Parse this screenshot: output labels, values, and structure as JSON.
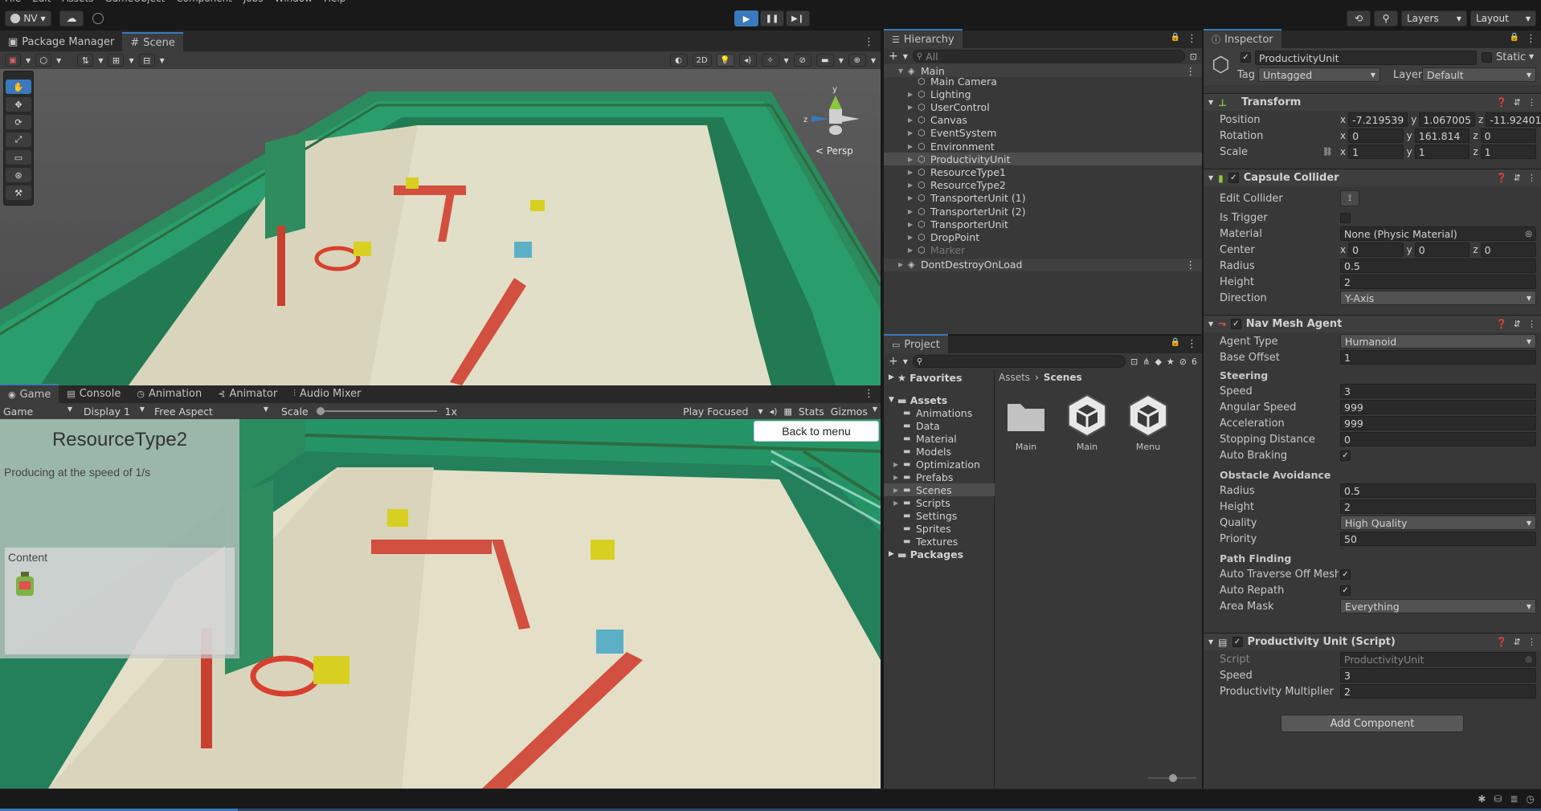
{
  "menubar": {
    "items": [
      "File",
      "Edit",
      "Assets",
      "GameObject",
      "Component",
      "Jobs",
      "Window",
      "Help"
    ]
  },
  "topbar": {
    "account": "NV",
    "layers": "Layers",
    "layout": "Layout"
  },
  "scene_tabs": {
    "package_manager": "Package Manager",
    "scene": "Scene"
  },
  "scene_toolbar": {
    "mode_2d": "2D",
    "persp": "< Persp"
  },
  "game_tabs": {
    "game": "Game",
    "console": "Console",
    "animation": "Animation",
    "animator": "Animator",
    "audio_mixer": "Audio Mixer"
  },
  "game_toolbar": {
    "view": "Game",
    "display": "Display 1",
    "aspect": "Free Aspect",
    "scale_label": "Scale",
    "scale_value": "1x",
    "play_mode": "Play Focused",
    "stats": "Stats",
    "gizmos": "Gizmos"
  },
  "game_ui": {
    "title": "ResourceType2",
    "subtitle": "Producing at the speed of 1/s",
    "content_label": "Content",
    "back_button": "Back to menu"
  },
  "hierarchy": {
    "title": "Hierarchy",
    "search_placeholder": "All",
    "scene": "Main",
    "items": [
      "Main Camera",
      "Lighting",
      "UserControl",
      "Canvas",
      "EventSystem",
      "Environment",
      "ProductivityUnit",
      "ResourceType1",
      "ResourceType2",
      "TransporterUnit (1)",
      "TransporterUnit (2)",
      "TransporterUnit",
      "DropPoint",
      "Marker"
    ],
    "dont_destroy": "DontDestroyOnLoad"
  },
  "project": {
    "title": "Project",
    "favorites": "Favorites",
    "assets": "Assets",
    "folders": [
      "Animations",
      "Data",
      "Material",
      "Models",
      "Optimization",
      "Prefabs",
      "Scenes",
      "Scripts",
      "Settings",
      "Sprites",
      "Textures"
    ],
    "packages": "Packages",
    "breadcrumb_root": "Assets",
    "breadcrumb_current": "Scenes",
    "hidden_count": "6",
    "files": [
      {
        "name": "Main",
        "icon": "folder-icon"
      },
      {
        "name": "Main",
        "icon": "unity-scene-icon"
      },
      {
        "name": "Menu",
        "icon": "unity-scene-icon"
      }
    ]
  },
  "inspector": {
    "title": "Inspector",
    "object_name": "ProductivityUnit",
    "static_label": "Static",
    "tag_label": "Tag",
    "tag_value": "Untagged",
    "layer_label": "Layer",
    "layer_value": "Default",
    "transform": {
      "title": "Transform",
      "position_label": "Position",
      "position": [
        "-7.219539",
        "1.067005",
        "-11.92401"
      ],
      "rotation_label": "Rotation",
      "rotation": [
        "0",
        "161.814",
        "0"
      ],
      "scale_label": "Scale",
      "scale": [
        "1",
        "1",
        "1"
      ]
    },
    "capsule": {
      "title": "Capsule Collider",
      "edit_label": "Edit Collider",
      "trigger_label": "Is Trigger",
      "material_label": "Material",
      "material_value": "None (Physic Material)",
      "center_label": "Center",
      "center": [
        "0",
        "0",
        "0"
      ],
      "radius_label": "Radius",
      "radius": "0.5",
      "height_label": "Height",
      "height": "2",
      "direction_label": "Direction",
      "direction": "Y-Axis"
    },
    "navmesh": {
      "title": "Nav Mesh Agent",
      "agent_type_label": "Agent Type",
      "agent_type": "Humanoid",
      "base_offset_label": "Base Offset",
      "base_offset": "1",
      "steering": "Steering",
      "speed_label": "Speed",
      "speed": "3",
      "angular_label": "Angular Speed",
      "angular": "999",
      "accel_label": "Acceleration",
      "accel": "999",
      "stop_label": "Stopping Distance",
      "stop": "0",
      "braking_label": "Auto Braking",
      "obstacle": "Obstacle Avoidance",
      "o_radius_label": "Radius",
      "o_radius": "0.5",
      "o_height_label": "Height",
      "o_height": "2",
      "quality_label": "Quality",
      "quality": "High Quality",
      "priority_label": "Priority",
      "priority": "50",
      "path": "Path Finding",
      "traverse_label": "Auto Traverse Off Mesh Lir",
      "repath_label": "Auto Repath",
      "area_label": "Area Mask",
      "area": "Everything"
    },
    "script": {
      "title": "Productivity Unit (Script)",
      "script_label": "Script",
      "script_value": "ProductivityUnit",
      "speed_label": "Speed",
      "speed": "3",
      "mult_label": "Productivity Multiplier",
      "mult": "2"
    },
    "add_component": "Add Component"
  },
  "axes": {
    "x": "x",
    "y": "y",
    "z": "z"
  },
  "colors": {
    "accent": "#3a79bb",
    "panel": "#383838",
    "wall": "#2e8c5f",
    "floor": "#e4e0c8"
  }
}
